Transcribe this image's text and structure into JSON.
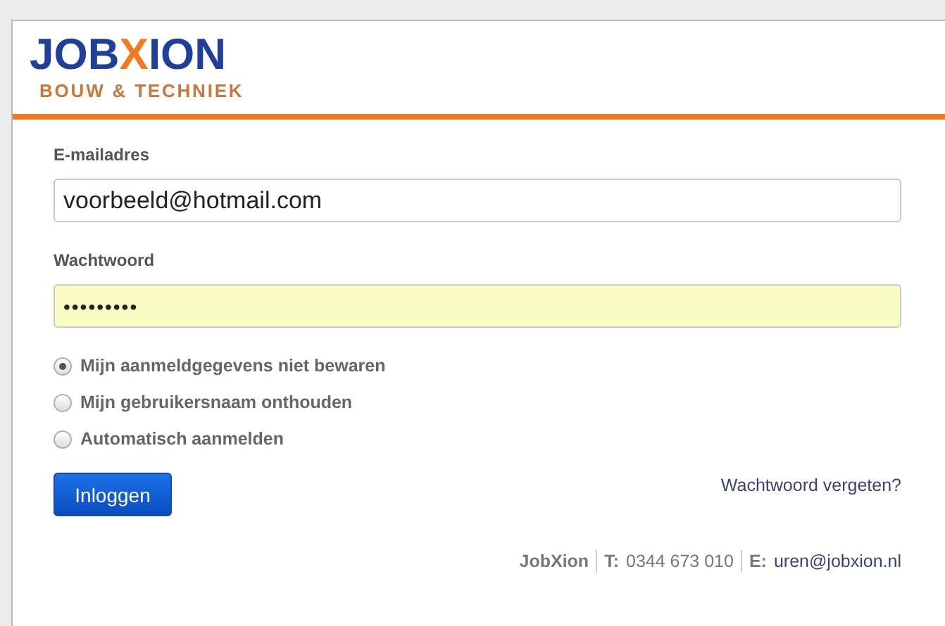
{
  "logo": {
    "before": "JOB",
    "accent": "X",
    "after": "ION",
    "tagline": "BOUW & TECHNIEK"
  },
  "email": {
    "label": "E-mailadres",
    "value": "voorbeeld@hotmail.com"
  },
  "password": {
    "label": "Wachtwoord",
    "value": "•••••••••",
    "autofilled": true
  },
  "options": [
    {
      "label": "Mijn aanmeldgegevens niet bewaren",
      "selected": true
    },
    {
      "label": "Mijn gebruikersnaam onthouden",
      "selected": false
    },
    {
      "label": "Automatisch aanmelden",
      "selected": false
    }
  ],
  "login_button": "Inloggen",
  "forgot_link": "Wachtwoord vergeten?",
  "footer": {
    "company": "JobXion",
    "phone_label": "T:",
    "phone": "0344 673 010",
    "email_label": "E:",
    "email": "uren@jobxion.nl"
  }
}
